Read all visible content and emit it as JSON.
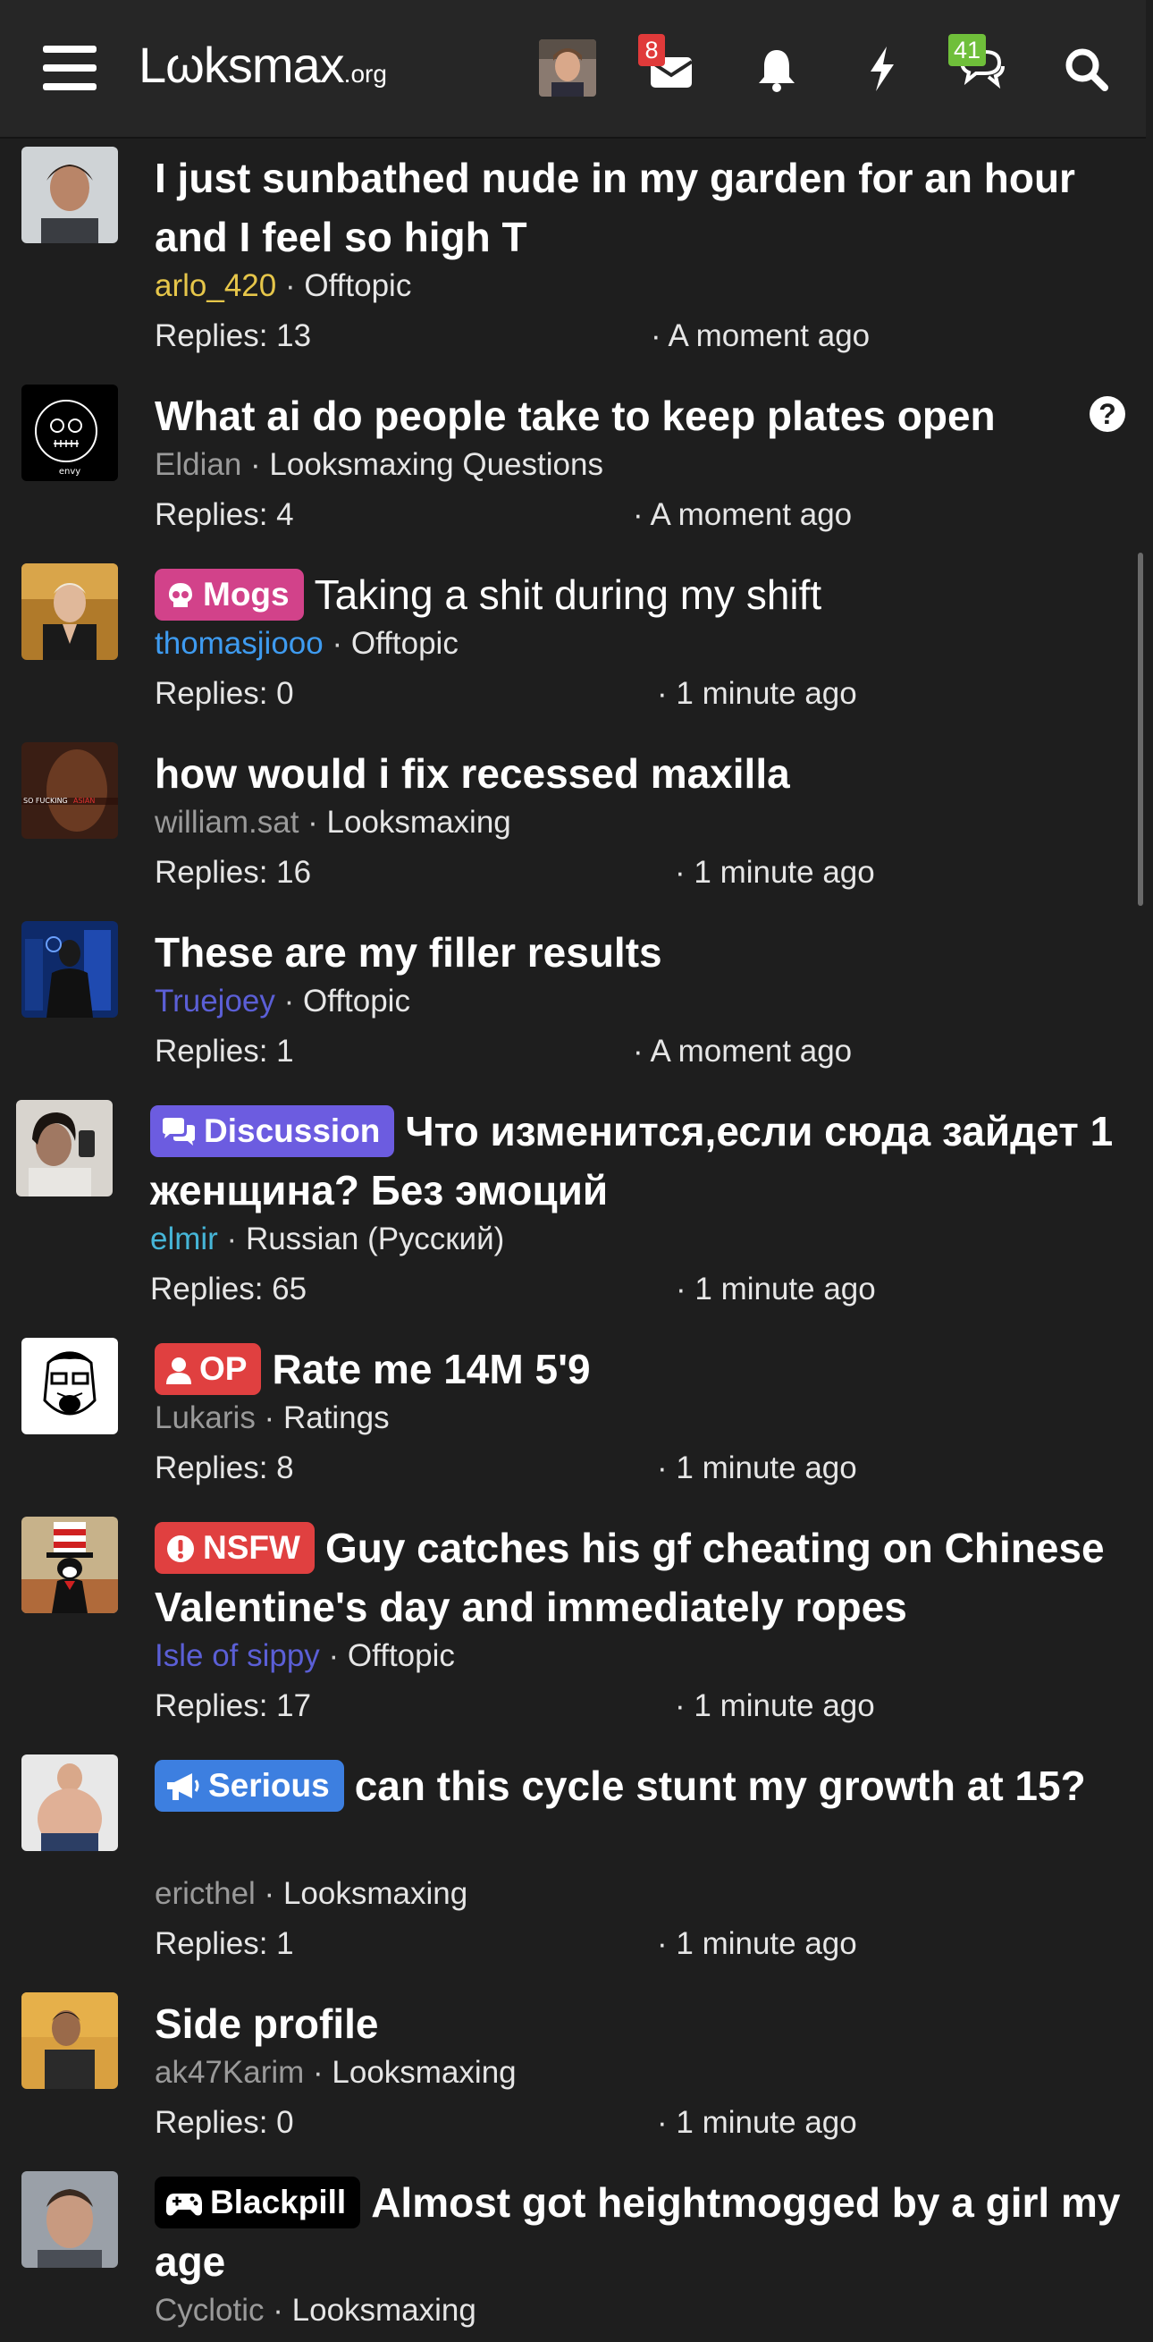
{
  "header": {
    "logo_main": "Lωksmax",
    "logo_suffix": ".org",
    "inbox_badge": "8",
    "messages_badge": "41",
    "colors": {
      "inbox_badge": "#e03a3a",
      "messages_badge": "#6fbf3a"
    },
    "icons": [
      "menu-icon",
      "envelope-icon",
      "bell-icon",
      "bolt-icon",
      "chat-icon",
      "search-icon"
    ]
  },
  "threads": [
    {
      "title": "I just sunbathed nude in my garden for an hour and I feel so high T",
      "author": "arlo_420",
      "author_color": "#e6c64a",
      "forum": "Offtopic",
      "replies": "Replies: 13",
      "time": "· A moment ago"
    },
    {
      "title": "What ai do people take to keep plates open",
      "author": "Eldian",
      "author_color": "#9a9a9a",
      "forum": "Looksmaxing Questions",
      "replies": "Replies: 4",
      "time": "· A moment ago",
      "status_icon": "question-icon"
    },
    {
      "prefix": "Mogs",
      "prefix_color": "#d2428a",
      "prefix_icon": "skull-icon",
      "title": "Taking a shit during my shift",
      "author": "thomasjiooo",
      "author_color": "#3e9bf0",
      "forum": "Offtopic",
      "replies": "Replies: 0",
      "time": "· 1 minute ago"
    },
    {
      "title": "how would i fix recessed maxilla",
      "author": "william.sat",
      "author_color": "#9a9a9a",
      "forum": "Looksmaxing",
      "replies": "Replies: 16",
      "time": "· 1 minute ago"
    },
    {
      "title": "These are my filler results",
      "author": "Truejoey",
      "author_color": "#5b5fd6",
      "forum": "Offtopic",
      "replies": "Replies: 1",
      "time": "· A moment ago"
    },
    {
      "prefix": "Discussion",
      "prefix_color": "#6c5ce0",
      "prefix_icon": "chat-bubbles-icon",
      "title": "Что изменится,если сюда зайдет 1 женщина? Без эмоций",
      "author": "elmir",
      "author_color": "#46b6d8",
      "forum": "Russian (Русский)",
      "replies": "Replies: 65",
      "time": "· 1 minute ago"
    },
    {
      "prefix": "OP",
      "prefix_color": "#e04040",
      "prefix_icon": "user-icon",
      "title": "Rate me 14M 5'9",
      "author": "Lukaris",
      "author_color": "#9a9a9a",
      "forum": "Ratings",
      "replies": "Replies: 8",
      "time": "· 1 minute ago"
    },
    {
      "prefix": "NSFW",
      "prefix_color": "#e04040",
      "prefix_icon": "alert-icon",
      "title": "Guy catches his gf cheating on Chinese Valentine's day and immediately ropes",
      "author": "Isle of sippy",
      "author_color": "#5b5fd6",
      "forum": "Offtopic",
      "replies": "Replies: 17",
      "time": "· 1 minute ago"
    },
    {
      "prefix": "Serious",
      "prefix_color": "#3d7fe0",
      "prefix_icon": "megaphone-icon",
      "title": "can this cycle stunt my growth at 15?",
      "author": "ericthel",
      "author_color": "#9a9a9a",
      "forum": "Looksmaxing",
      "replies": "Replies: 1",
      "time": "· 1 minute ago"
    },
    {
      "title": "Side profile",
      "author": "ak47Karim",
      "author_color": "#9a9a9a",
      "forum": "Looksmaxing",
      "replies": "Replies: 0",
      "time": "· 1 minute ago"
    },
    {
      "prefix": "Blackpill",
      "prefix_color": "#000000",
      "prefix_icon": "gamepad-icon",
      "title": "Almost got heightmogged by a girl my age",
      "author": "Cyclotic",
      "author_color": "#9a9a9a",
      "forum": "Looksmaxing"
    }
  ]
}
